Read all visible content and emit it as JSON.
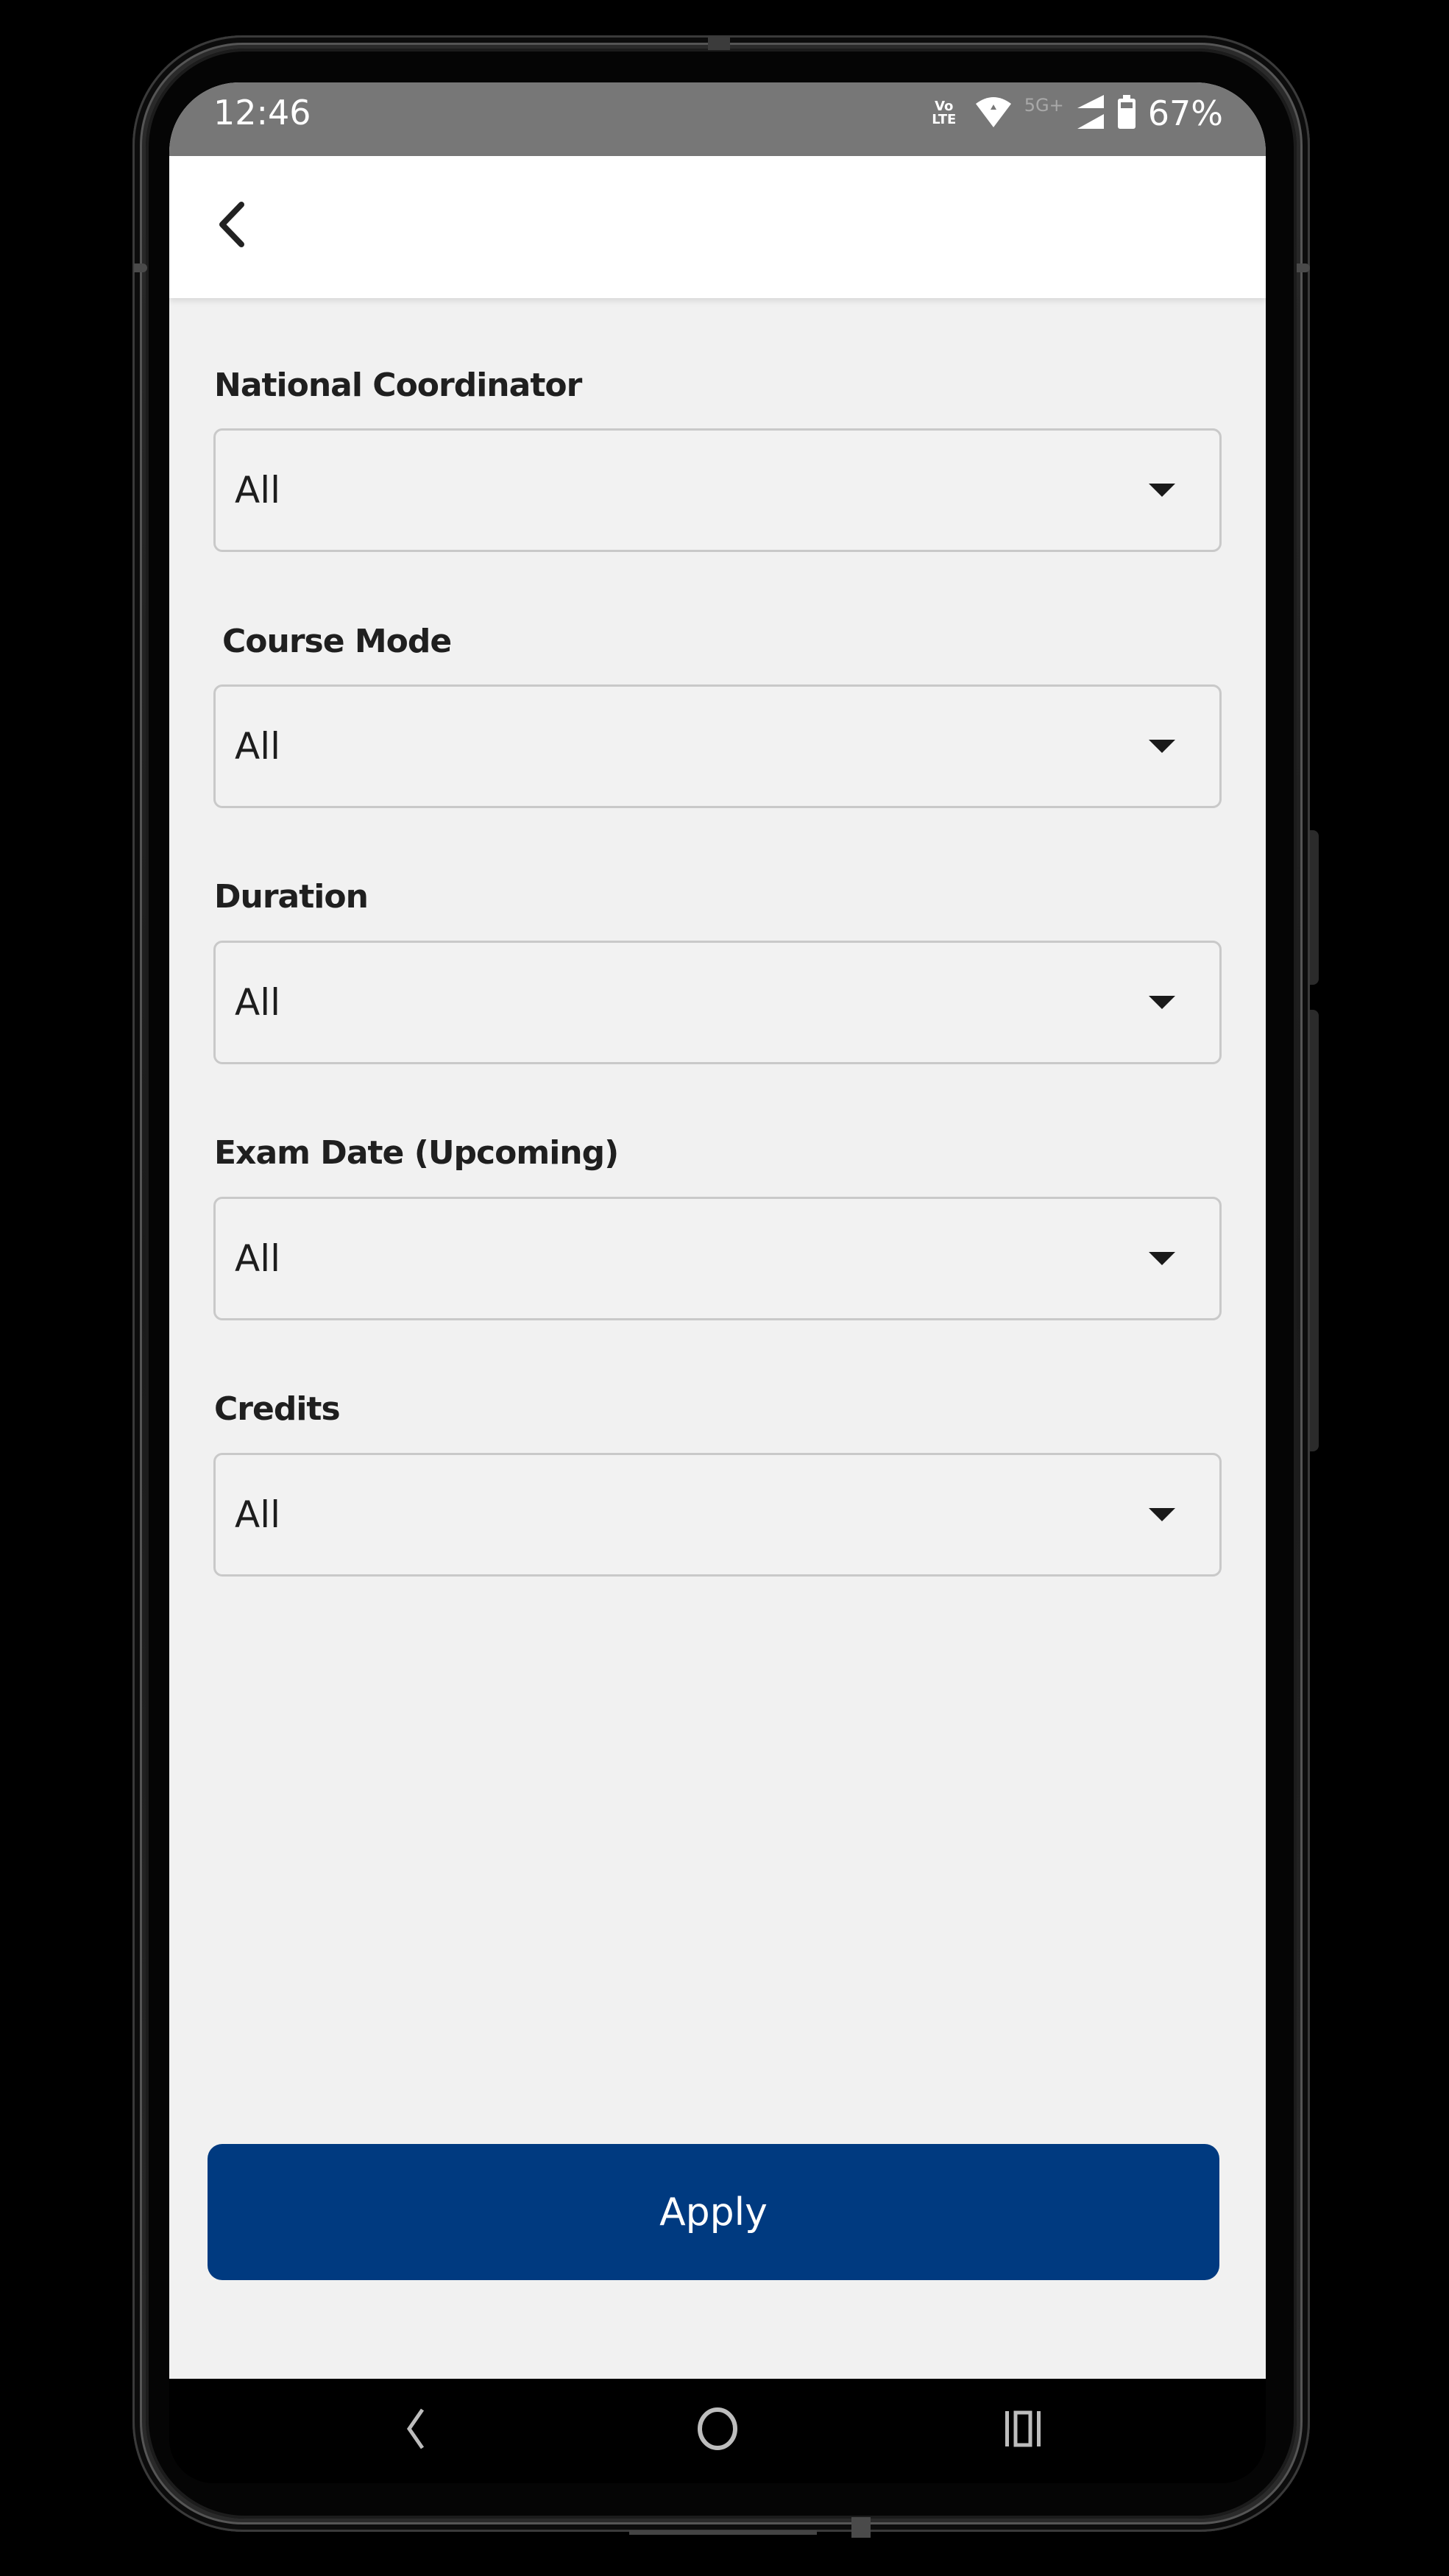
{
  "status_bar": {
    "time": "12:46",
    "volte_top": "Vo",
    "volte_bottom": "LTE",
    "network_type": "5G+",
    "battery_percent": "67%",
    "icons": [
      "volte-icon",
      "wifi-icon",
      "signal-icon",
      "battery-icon"
    ]
  },
  "app_bar": {
    "back_icon": "chevron-left-icon"
  },
  "filters": [
    {
      "label": "National Coordinator",
      "value": "All"
    },
    {
      "label": "Course Mode",
      "value": "All"
    },
    {
      "label": "Duration",
      "value": "All"
    },
    {
      "label": "Exam Date (Upcoming)",
      "value": "All"
    },
    {
      "label": "Credits",
      "value": "All"
    }
  ],
  "actions": {
    "apply_label": "Apply"
  },
  "colors": {
    "primary": "#003a80",
    "status_bar": "#777777",
    "background": "#f1f1f1"
  },
  "system_nav": {
    "back": "back-icon",
    "home": "home-icon",
    "recents": "recents-icon"
  }
}
